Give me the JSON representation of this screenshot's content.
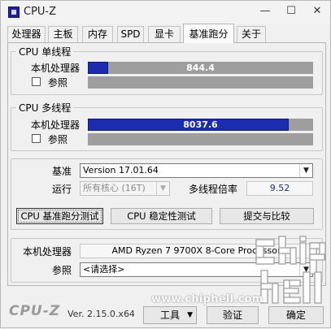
{
  "window": {
    "title": "CPU-Z",
    "controls": {
      "minimize": "—",
      "maximize": "☐",
      "close": "✕"
    }
  },
  "tabs": [
    {
      "label": "处理器"
    },
    {
      "label": "主板"
    },
    {
      "label": "内存"
    },
    {
      "label": "SPD"
    },
    {
      "label": "显卡"
    },
    {
      "label": "基准跑分",
      "active": true
    },
    {
      "label": "关于"
    }
  ],
  "single_thread": {
    "title": "CPU 单线程",
    "this_cpu_label": "本机处理器",
    "this_cpu_score": "844.4",
    "this_cpu_fill_fraction": 0.09,
    "reference_label": "参照"
  },
  "multi_thread": {
    "title": "CPU 多线程",
    "this_cpu_label": "本机处理器",
    "this_cpu_score": "8037.6",
    "this_cpu_fill_fraction": 0.89,
    "reference_label": "参照"
  },
  "settings": {
    "benchmark_label": "基准",
    "benchmark_value": "Version 17.01.64",
    "threads_label": "运行",
    "threads_value": "所有核心 (16T)",
    "ratio_label": "多线程倍率",
    "ratio_value": "9.52",
    "buttons": {
      "bench_cpu": "CPU 基准跑分测试",
      "stress_cpu": "CPU 稳定性测试",
      "submit": "提交与比较"
    }
  },
  "bottom": {
    "this_cpu_label": "本机处理器",
    "this_cpu_value": "AMD Ryzen 7 9700X 8-Core Processor",
    "reference_label": "参照",
    "reference_value": "<请选择>"
  },
  "footer": {
    "logo": "CPU-Z",
    "version": "Ver. 2.15.0.x64",
    "tools_label": "工具",
    "validate_label": "验证",
    "ok_label": "确定"
  },
  "watermark": {
    "url": "www.chiphell.com"
  },
  "colors": {
    "bar_fill": "#1b2cb0",
    "bar_bg": "#9e9e9e",
    "ratio_text": "#1a2b8a"
  }
}
